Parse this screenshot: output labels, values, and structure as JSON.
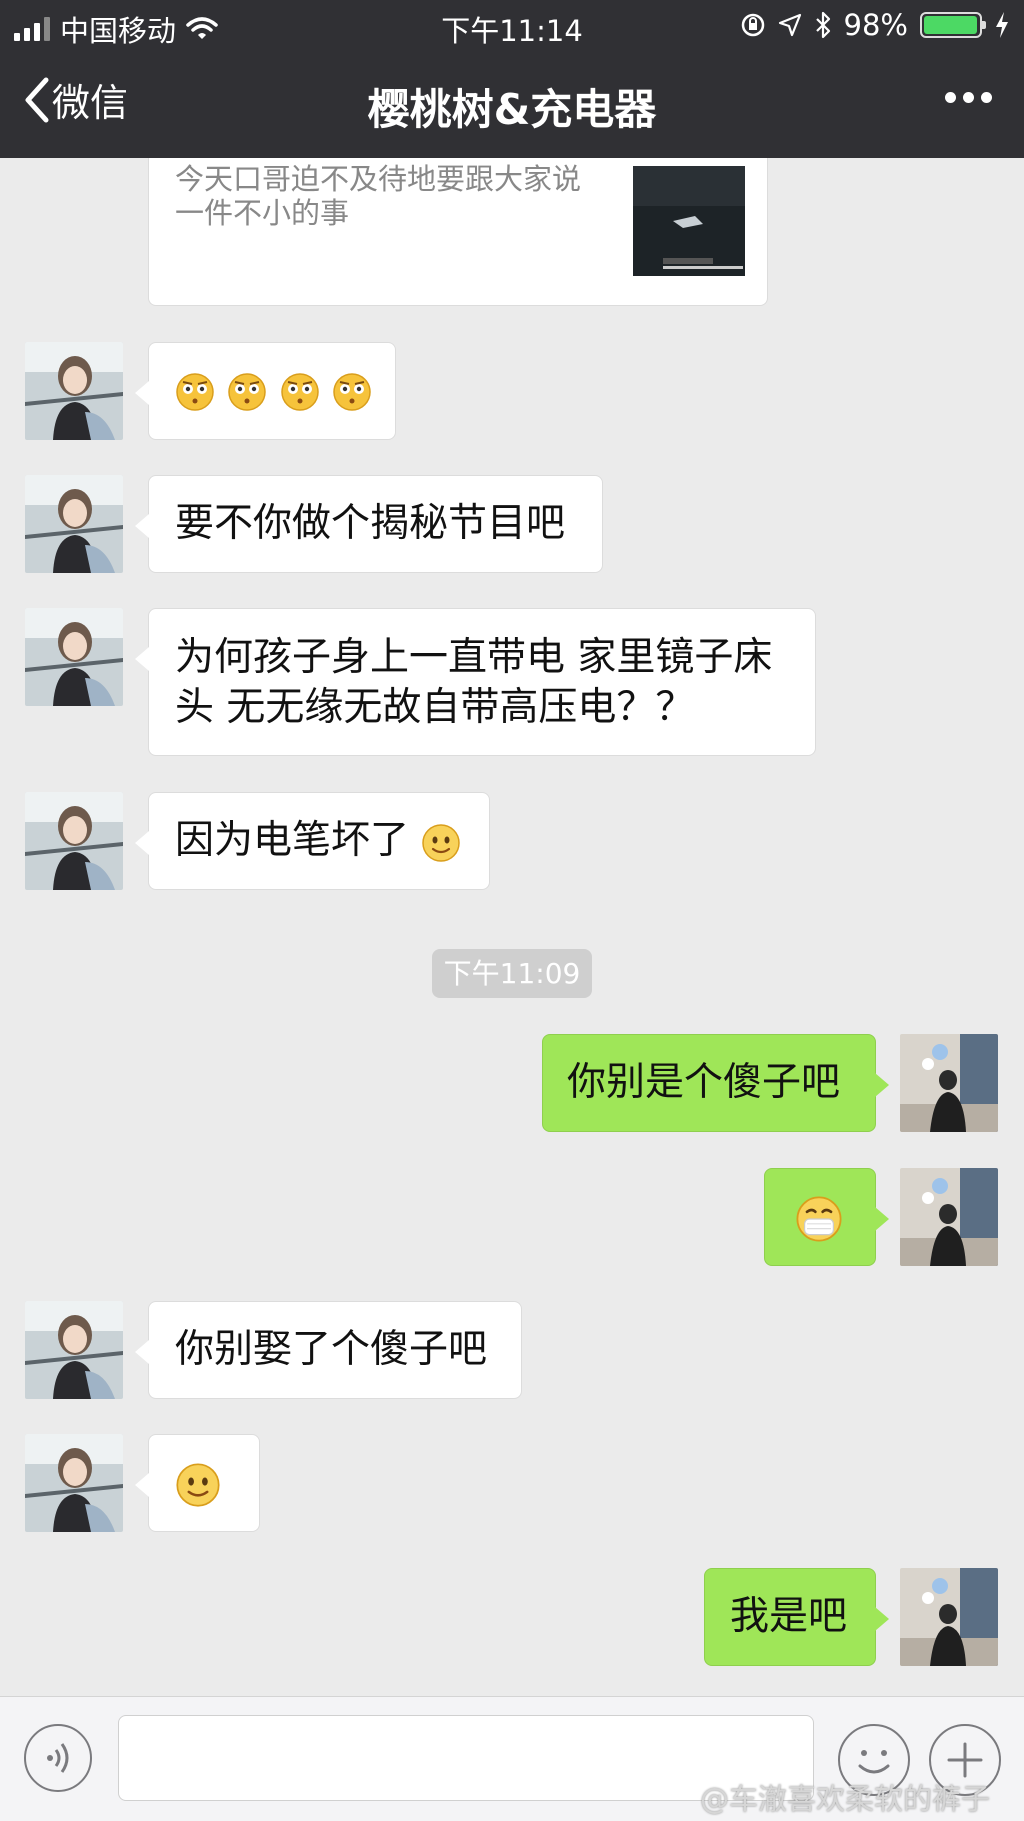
{
  "status_bar": {
    "carrier": "中国移动",
    "time": "下午11:14",
    "battery_percent": "98%",
    "battery_level": 0.98,
    "icons": [
      "signal-icon",
      "wifi-icon",
      "orientation-lock-icon",
      "location-icon",
      "bluetooth-icon",
      "battery-icon",
      "charging-icon"
    ]
  },
  "nav": {
    "back_label": "微信",
    "title": "樱桃树&充电器",
    "more_icon": "more-icon"
  },
  "link_card": {
    "text": "今天口哥迫不及待地要跟大家说一件不小的事"
  },
  "messages": [
    {
      "side": "left",
      "text": "",
      "emojis": [
        "staring-face",
        "staring-face",
        "staring-face",
        "staring-face"
      ]
    },
    {
      "side": "left",
      "text": "要不你做个揭秘节目吧"
    },
    {
      "side": "left",
      "text": "为何孩子身上一直带电 家里镜子床头 无无缘无故自带高压电？？"
    },
    {
      "side": "left",
      "text": "因为电笔坏了",
      "emojis": [
        "smile-face"
      ]
    },
    {
      "side": "right",
      "text": "你别是个傻子吧"
    },
    {
      "side": "right",
      "text": "",
      "emojis": [
        "mask-face"
      ]
    },
    {
      "side": "left",
      "text": "你别娶了个傻子吧"
    },
    {
      "side": "left",
      "text": "",
      "emojis": [
        "smile-face"
      ]
    },
    {
      "side": "right",
      "text": "我是吧"
    }
  ],
  "timestamp": "下午11:09",
  "input_bar": {
    "voice_icon": "voice-icon",
    "emoji_icon": "emoji-icon",
    "plus_icon": "plus-icon"
  },
  "watermark": "@车澈喜欢柔软的裤子",
  "colors": {
    "nav_bg": "#303034",
    "chat_bg": "#ebebeb",
    "sent_bubble": "#9fe658",
    "received_bubble": "#ffffff"
  }
}
